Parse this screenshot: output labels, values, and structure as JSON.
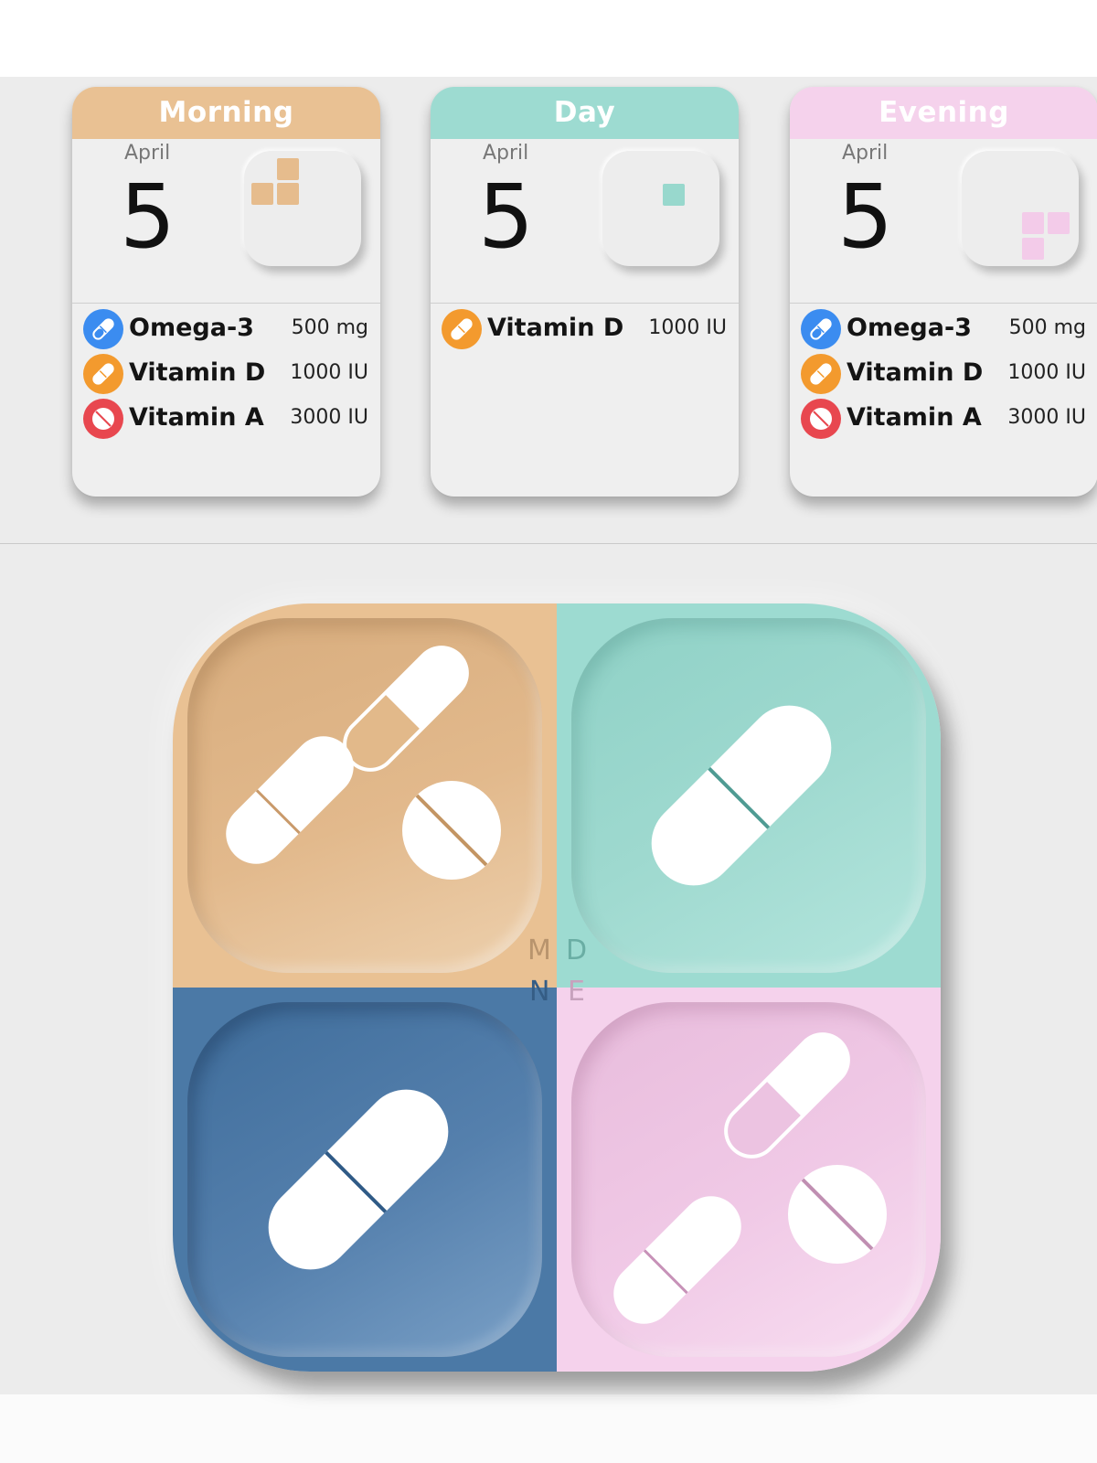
{
  "colors": {
    "morning": "#e9c193",
    "day": "#9ddbd1",
    "evening": "#f5d2ec",
    "night": "#4b79a6",
    "blue_icon": "#3b8cf0",
    "orange_icon": "#f39a2e",
    "red_icon": "#e8474f"
  },
  "widgets": [
    {
      "title": "Morning",
      "month": "April",
      "day": "5",
      "color": "#e9c193",
      "items": [
        {
          "name": "Omega-3",
          "dose": "500 mg",
          "icon": "capsule-blue-icon"
        },
        {
          "name": "Vitamin D",
          "dose": "1000 IU",
          "icon": "capsule-orange-icon"
        },
        {
          "name": "Vitamin A",
          "dose": "3000 IU",
          "icon": "tablet-red-icon"
        }
      ]
    },
    {
      "title": "Day",
      "month": "April",
      "day": "5",
      "color": "#9ddbd1",
      "items": [
        {
          "name": "Vitamin D",
          "dose": "1000 IU",
          "icon": "capsule-orange-icon"
        }
      ]
    },
    {
      "title": "Evening",
      "month": "April",
      "day": "5",
      "color": "#f5d2ec",
      "items": [
        {
          "name": "Omega-3",
          "dose": "500 mg",
          "icon": "capsule-blue-icon"
        },
        {
          "name": "Vitamin D",
          "dose": "1000 IU",
          "icon": "capsule-orange-icon"
        },
        {
          "name": "Vitamin A",
          "dose": "3000 IU",
          "icon": "tablet-red-icon"
        }
      ]
    }
  ],
  "organizer": {
    "letters": {
      "morning": "M",
      "day": "D",
      "night": "N",
      "evening": "E"
    }
  }
}
